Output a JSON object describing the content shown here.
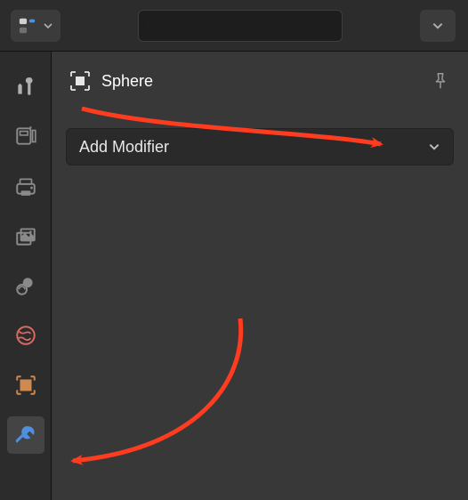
{
  "header": {
    "editor_type_tooltip": "Properties",
    "search_placeholder": ""
  },
  "rail": {
    "items": [
      {
        "key": "tool",
        "icon": "tool-icon"
      },
      {
        "key": "render",
        "icon": "render-icon"
      },
      {
        "key": "output",
        "icon": "output-icon"
      },
      {
        "key": "viewlayer",
        "icon": "viewlayer-icon"
      },
      {
        "key": "scene",
        "icon": "scene-icon"
      },
      {
        "key": "world",
        "icon": "world-icon"
      },
      {
        "key": "object",
        "icon": "object-icon"
      },
      {
        "key": "modifier",
        "icon": "wrench-icon"
      }
    ],
    "active": "modifier"
  },
  "panel": {
    "object_name": "Sphere",
    "add_modifier_label": "Add Modifier"
  },
  "annotation": {
    "color": "#ff3c1f"
  }
}
